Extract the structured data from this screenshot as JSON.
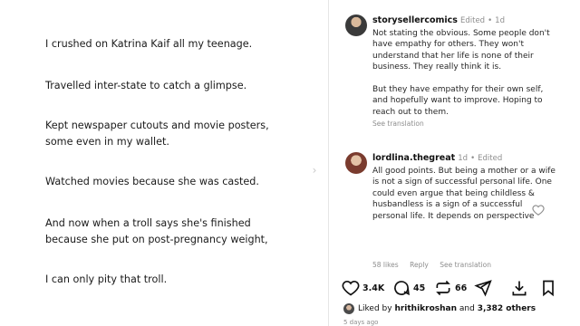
{
  "post": {
    "lines": [
      "I crushed on Katrina Kaif all my teenage.",
      "Travelled inter-state to catch a glimpse.",
      "Kept newspaper cutouts and movie posters,",
      "some even in my wallet.",
      "Watched movies because she was casted.",
      "And now when a troll says she's finished",
      "because she put on post-pregnancy weight,",
      "I can only pity that troll."
    ]
  },
  "comments": [
    {
      "username": "storysellercomics",
      "edited": "Edited",
      "time": "1d",
      "text1": "Not stating the obvious. Some people don't have empathy for others. They won't understand that her life is none of their business. They really think it is.",
      "text2": "But they have empathy for their own self, and hopefully want to improve. Hoping to reach out to them.",
      "see_translation": "See translation"
    },
    {
      "username": "lordlina.thegreat",
      "time": "1d",
      "edited": "Edited",
      "text1": "All good points. But being a mother or a wife is not a sign of successful personal life. One could even argue that being childless & husbandless is a sign of a successful personal life. It depends on perspective",
      "likes": "58 likes",
      "reply": "Reply",
      "see_translation": "See translation"
    }
  ],
  "action_bar": {
    "like_count": "3.4K",
    "comment_count": "45",
    "repost_count": "66"
  },
  "liked_by": {
    "prefix": "Liked by",
    "user": "hrithikroshan",
    "and": "and",
    "others": "3,382 others"
  },
  "time_ago": "5 days ago",
  "icons": {
    "like": "heart-icon",
    "comment": "comment-icon",
    "repost": "repost-icon",
    "share": "share-icon",
    "save_download": "download-icon",
    "bookmark": "bookmark-icon"
  }
}
